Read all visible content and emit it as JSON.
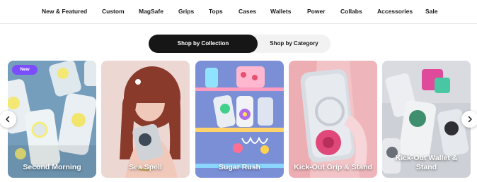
{
  "nav": {
    "items": [
      "New & Featured",
      "Custom",
      "MagSafe",
      "Grips",
      "Tops",
      "Cases",
      "Wallets",
      "Power",
      "Collabs",
      "Accessories",
      "Sale"
    ]
  },
  "toggle": {
    "active_label": "Shop by Collection",
    "inactive_label": "Shop by Category"
  },
  "cards": [
    {
      "title": "Second Morning",
      "badge": "New"
    },
    {
      "title": "Sea Spell"
    },
    {
      "title": "Sugar Rush"
    },
    {
      "title": "Kick-Out Grip & Stand"
    },
    {
      "title": "Kick-Out Wallet & Stand"
    }
  ],
  "icons": {
    "prev": "chevron-left-icon",
    "next": "chevron-right-icon"
  },
  "colors": {
    "toggle_active_bg": "#161616",
    "badge_bg": "#7c4dff"
  }
}
